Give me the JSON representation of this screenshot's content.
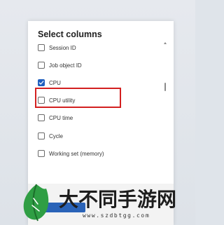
{
  "dialog": {
    "title": "Select columns",
    "columns": [
      {
        "label": "Session ID",
        "checked": false
      },
      {
        "label": "Job object ID",
        "checked": false
      },
      {
        "label": "CPU",
        "checked": true
      },
      {
        "label": "CPU utility",
        "checked": false
      },
      {
        "label": "CPU time",
        "checked": false
      },
      {
        "label": "Cycle",
        "checked": false
      },
      {
        "label": "Working set (memory)",
        "checked": false
      }
    ],
    "highlighted_column": "CPU utility"
  },
  "watermark": {
    "brand": "大不同手游网",
    "url": "www.szdbtgg.com"
  },
  "colors": {
    "accent": "#1f5fbf",
    "highlight": "#d32020",
    "watermark_logo": "#2f9e44"
  }
}
